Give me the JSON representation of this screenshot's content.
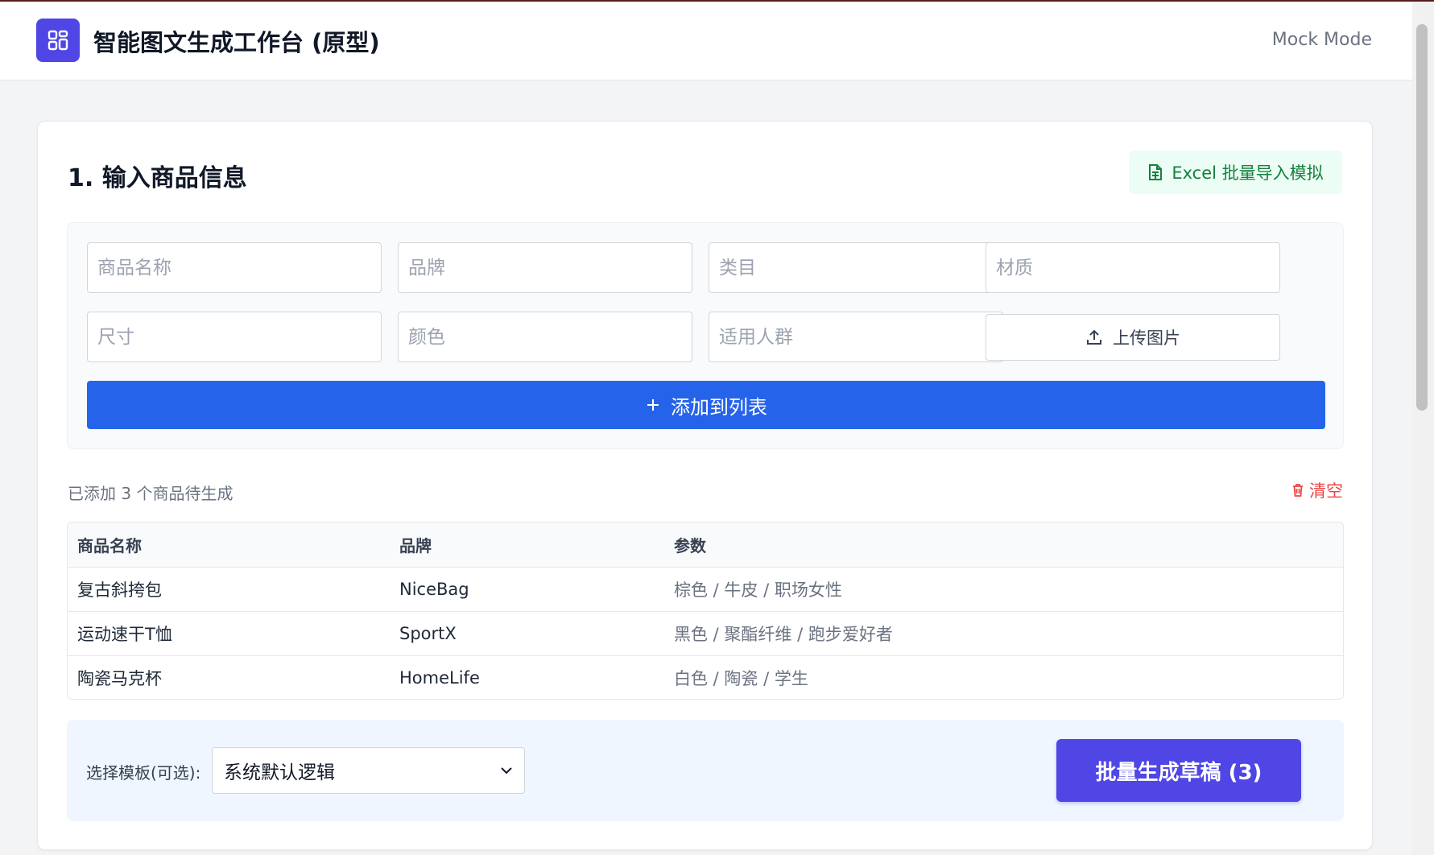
{
  "header": {
    "title": "智能图文生成工作台 (原型)",
    "mode": "Mock Mode",
    "logo_icon": "grid-icon"
  },
  "input_section": {
    "title": "1. 输入商品信息",
    "excel_button": "Excel 批量导入模拟",
    "fields": {
      "name": "商品名称",
      "brand": "品牌",
      "category": "类目",
      "material": "材质",
      "size": "尺寸",
      "color": "颜色",
      "audience": "适用人群"
    },
    "upload_button": "上传图片",
    "add_button": "添加到列表"
  },
  "list": {
    "count_text": "已添加 3 个商品待生成",
    "clear_button": "清空",
    "columns": [
      "商品名称",
      "品牌",
      "参数"
    ],
    "rows": [
      {
        "name": "复古斜挎包",
        "brand": "NiceBag",
        "params": "棕色 / 牛皮 / 职场女性"
      },
      {
        "name": "运动速干T恤",
        "brand": "SportX",
        "params": "黑色 / 聚酯纤维 / 跑步爱好者"
      },
      {
        "name": "陶瓷马克杯",
        "brand": "HomeLife",
        "params": "白色 / 陶瓷 / 学生"
      }
    ]
  },
  "generate": {
    "template_label": "选择模板(可选):",
    "template_selected": "系统默认逻辑",
    "button": "批量生成草稿 (3)"
  },
  "colors": {
    "primary": "#2563eb",
    "accent": "#4f46e5",
    "success": "#15803d",
    "danger": "#ef4444"
  }
}
